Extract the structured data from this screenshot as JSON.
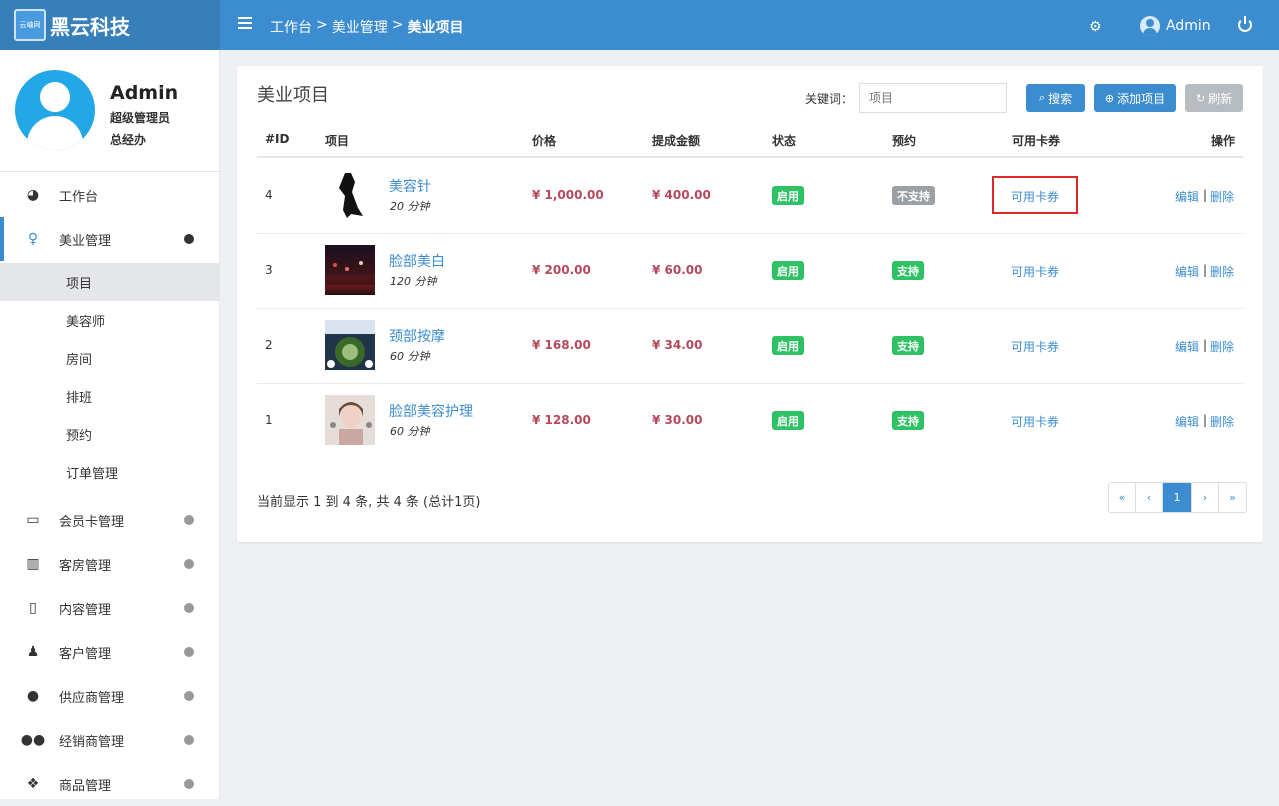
{
  "brand": {
    "name": "黑云科技",
    "logo_text": "云岫网"
  },
  "header": {
    "breadcrumb": [
      "工作台",
      ">",
      "美业管理",
      ">",
      "美业项目"
    ],
    "user": "Admin"
  },
  "profile": {
    "name": "Admin",
    "role": "超级管理员",
    "dept": "总经办"
  },
  "nav": {
    "items": [
      {
        "label": "工作台",
        "icon": "dashboard-icon"
      },
      {
        "label": "美业管理",
        "icon": "person-female-icon"
      },
      {
        "label": "会员卡管理",
        "icon": "credit-card-icon"
      },
      {
        "label": "客房管理",
        "icon": "building-icon"
      },
      {
        "label": "内容管理",
        "icon": "file-icon"
      },
      {
        "label": "客户管理",
        "icon": "person-icon"
      },
      {
        "label": "供应商管理",
        "icon": "user-icon"
      },
      {
        "label": "经销商管理",
        "icon": "users-icon"
      },
      {
        "label": "商品管理",
        "icon": "cubes-icon"
      }
    ],
    "subitems": [
      "项目",
      "美容师",
      "房间",
      "排班",
      "预约",
      "订单管理"
    ]
  },
  "panel": {
    "title": "美业项目",
    "keyword_label": "关键词：",
    "search_placeholder": "项目",
    "search_btn": "搜索",
    "add_btn": "添加项目",
    "refresh_btn": "刷新"
  },
  "table": {
    "headers": [
      "#ID",
      "项目",
      "价格",
      "提成金额",
      "状态",
      "预约",
      "可用卡券",
      "操作"
    ],
    "rows": [
      {
        "id": "4",
        "name": "美容针",
        "duration": "20 分钟",
        "price": "¥ 1,000.00",
        "commission": "¥ 400.00",
        "status": "启用",
        "booking": "不支持",
        "coupon": "可用卡券",
        "edit": "编辑",
        "sep": "|",
        "delete": "删除"
      },
      {
        "id": "3",
        "name": "脸部美白",
        "duration": "120 分钟",
        "price": "¥ 200.00",
        "commission": "¥ 60.00",
        "status": "启用",
        "booking": "支持",
        "coupon": "可用卡券",
        "edit": "编辑",
        "sep": "|",
        "delete": "删除"
      },
      {
        "id": "2",
        "name": "颈部按摩",
        "duration": "60 分钟",
        "price": "¥ 168.00",
        "commission": "¥ 34.00",
        "status": "启用",
        "booking": "支持",
        "coupon": "可用卡券",
        "edit": "编辑",
        "sep": "|",
        "delete": "删除"
      },
      {
        "id": "1",
        "name": "脸部美容护理",
        "duration": "60 分钟",
        "price": "¥ 128.00",
        "commission": "¥ 30.00",
        "status": "启用",
        "booking": "支持",
        "coupon": "可用卡券",
        "edit": "编辑",
        "sep": "|",
        "delete": "删除"
      }
    ]
  },
  "footer": {
    "info": "当前显示 1 到 4 条, 共 4 条 (总计1页)"
  },
  "pagination": [
    "«",
    "‹",
    "1",
    "›",
    "»"
  ],
  "colors": {
    "primary": "#3c8dd0",
    "success": "#2ec264",
    "price": "#b5485a",
    "highlight": "#d92b2b"
  }
}
